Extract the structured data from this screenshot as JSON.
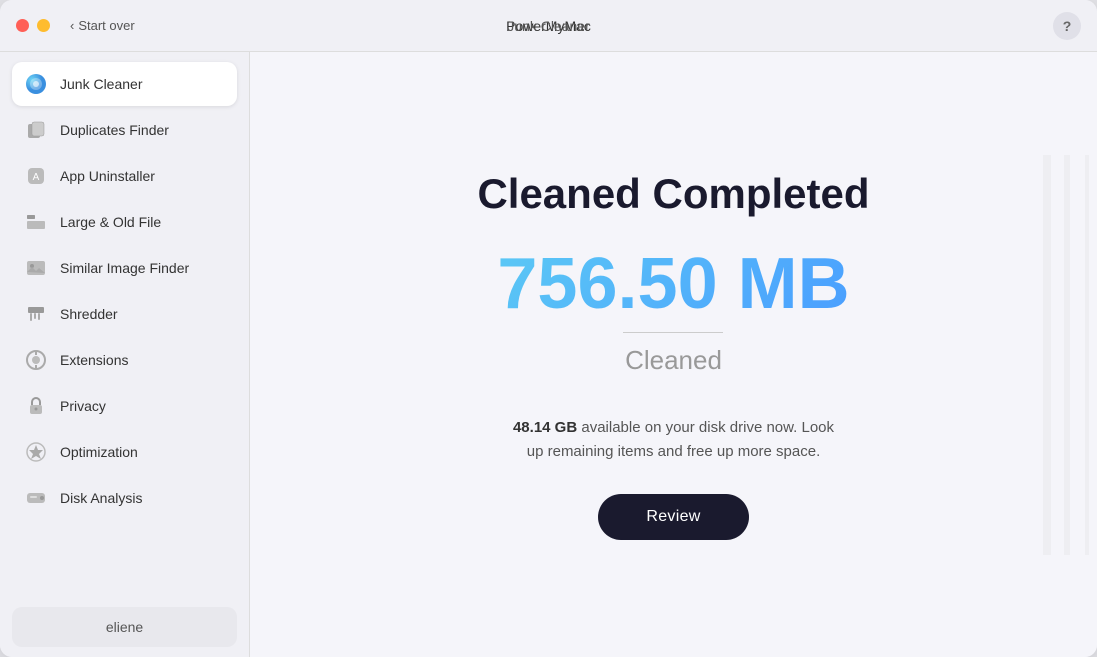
{
  "titleBar": {
    "appName": "PowerMyMac",
    "headerTitle": "Junk Cleaner",
    "startOver": "Start over",
    "helpLabel": "?"
  },
  "sidebar": {
    "items": [
      {
        "id": "junk-cleaner",
        "label": "Junk Cleaner",
        "active": true
      },
      {
        "id": "duplicates-finder",
        "label": "Duplicates Finder",
        "active": false
      },
      {
        "id": "app-uninstaller",
        "label": "App Uninstaller",
        "active": false
      },
      {
        "id": "large-old-file",
        "label": "Large & Old File",
        "active": false
      },
      {
        "id": "similar-image-finder",
        "label": "Similar Image Finder",
        "active": false
      },
      {
        "id": "shredder",
        "label": "Shredder",
        "active": false
      },
      {
        "id": "extensions",
        "label": "Extensions",
        "active": false
      },
      {
        "id": "privacy",
        "label": "Privacy",
        "active": false
      },
      {
        "id": "optimization",
        "label": "Optimization",
        "active": false
      },
      {
        "id": "disk-analysis",
        "label": "Disk Analysis",
        "active": false
      }
    ],
    "user": "eliene"
  },
  "content": {
    "title": "Cleaned Completed",
    "amount": "756.50 MB",
    "cleanedLabel": "Cleaned",
    "infoText": "48.14 GB  available on your disk drive now. Look up remaining items and free up more space.",
    "infoStrong": "48.14 GB",
    "reviewButton": "Review"
  }
}
